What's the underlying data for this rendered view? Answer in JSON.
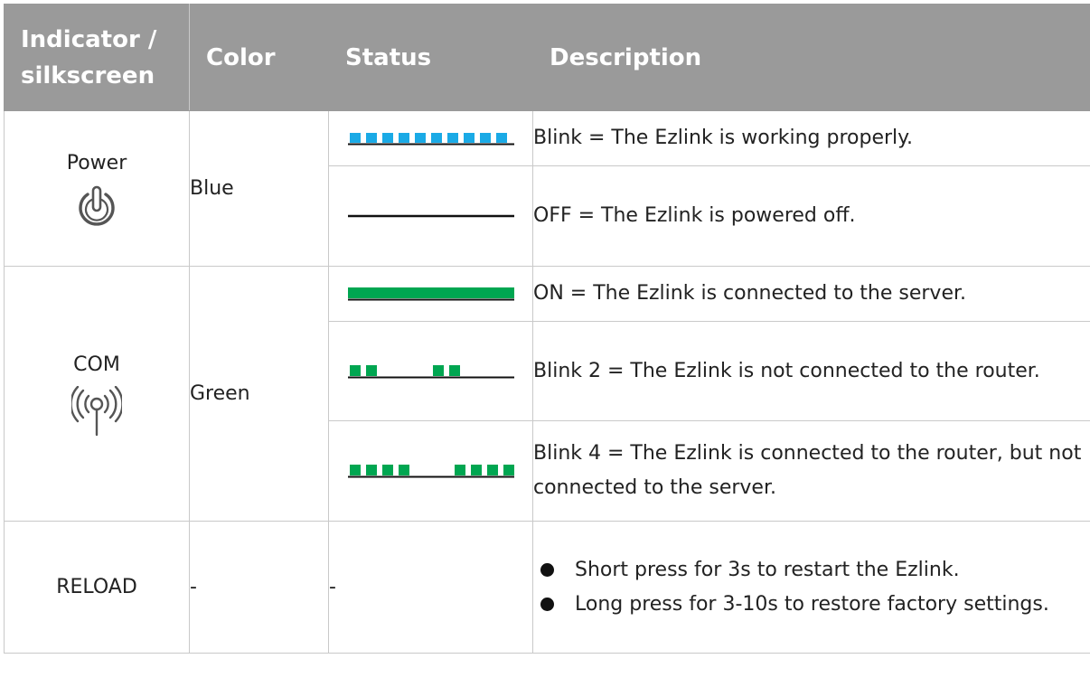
{
  "header": {
    "indicator": "Indicator / silkscreen",
    "color": "Color",
    "status": "Status",
    "description": "Description"
  },
  "power": {
    "name": "Power",
    "icon": "power-icon",
    "color": "Blue",
    "color_hex": "#1aaae6",
    "rows": [
      {
        "pattern": "blink-fast",
        "description": "Blink = The Ezlink is working properly."
      },
      {
        "pattern": "off",
        "description": "OFF = The Ezlink is powered off."
      }
    ]
  },
  "com": {
    "name": "COM",
    "icon": "antenna-signal-icon",
    "color": "Green",
    "color_hex": "#00a651",
    "rows": [
      {
        "pattern": "on",
        "description": "ON = The Ezlink is connected to the server."
      },
      {
        "pattern": "blink-2",
        "description": "Blink 2 = The Ezlink is not connected to the router."
      },
      {
        "pattern": "blink-4",
        "description": "Blink 4 = The Ezlink is connected to the router, but not connected to the server."
      }
    ]
  },
  "reload": {
    "name": "RELOAD",
    "color": "-",
    "status": "-",
    "bullets": [
      "Short press for 3s to restart the Ezlink.",
      "Long press for 3-10s to restore factory settings."
    ]
  }
}
